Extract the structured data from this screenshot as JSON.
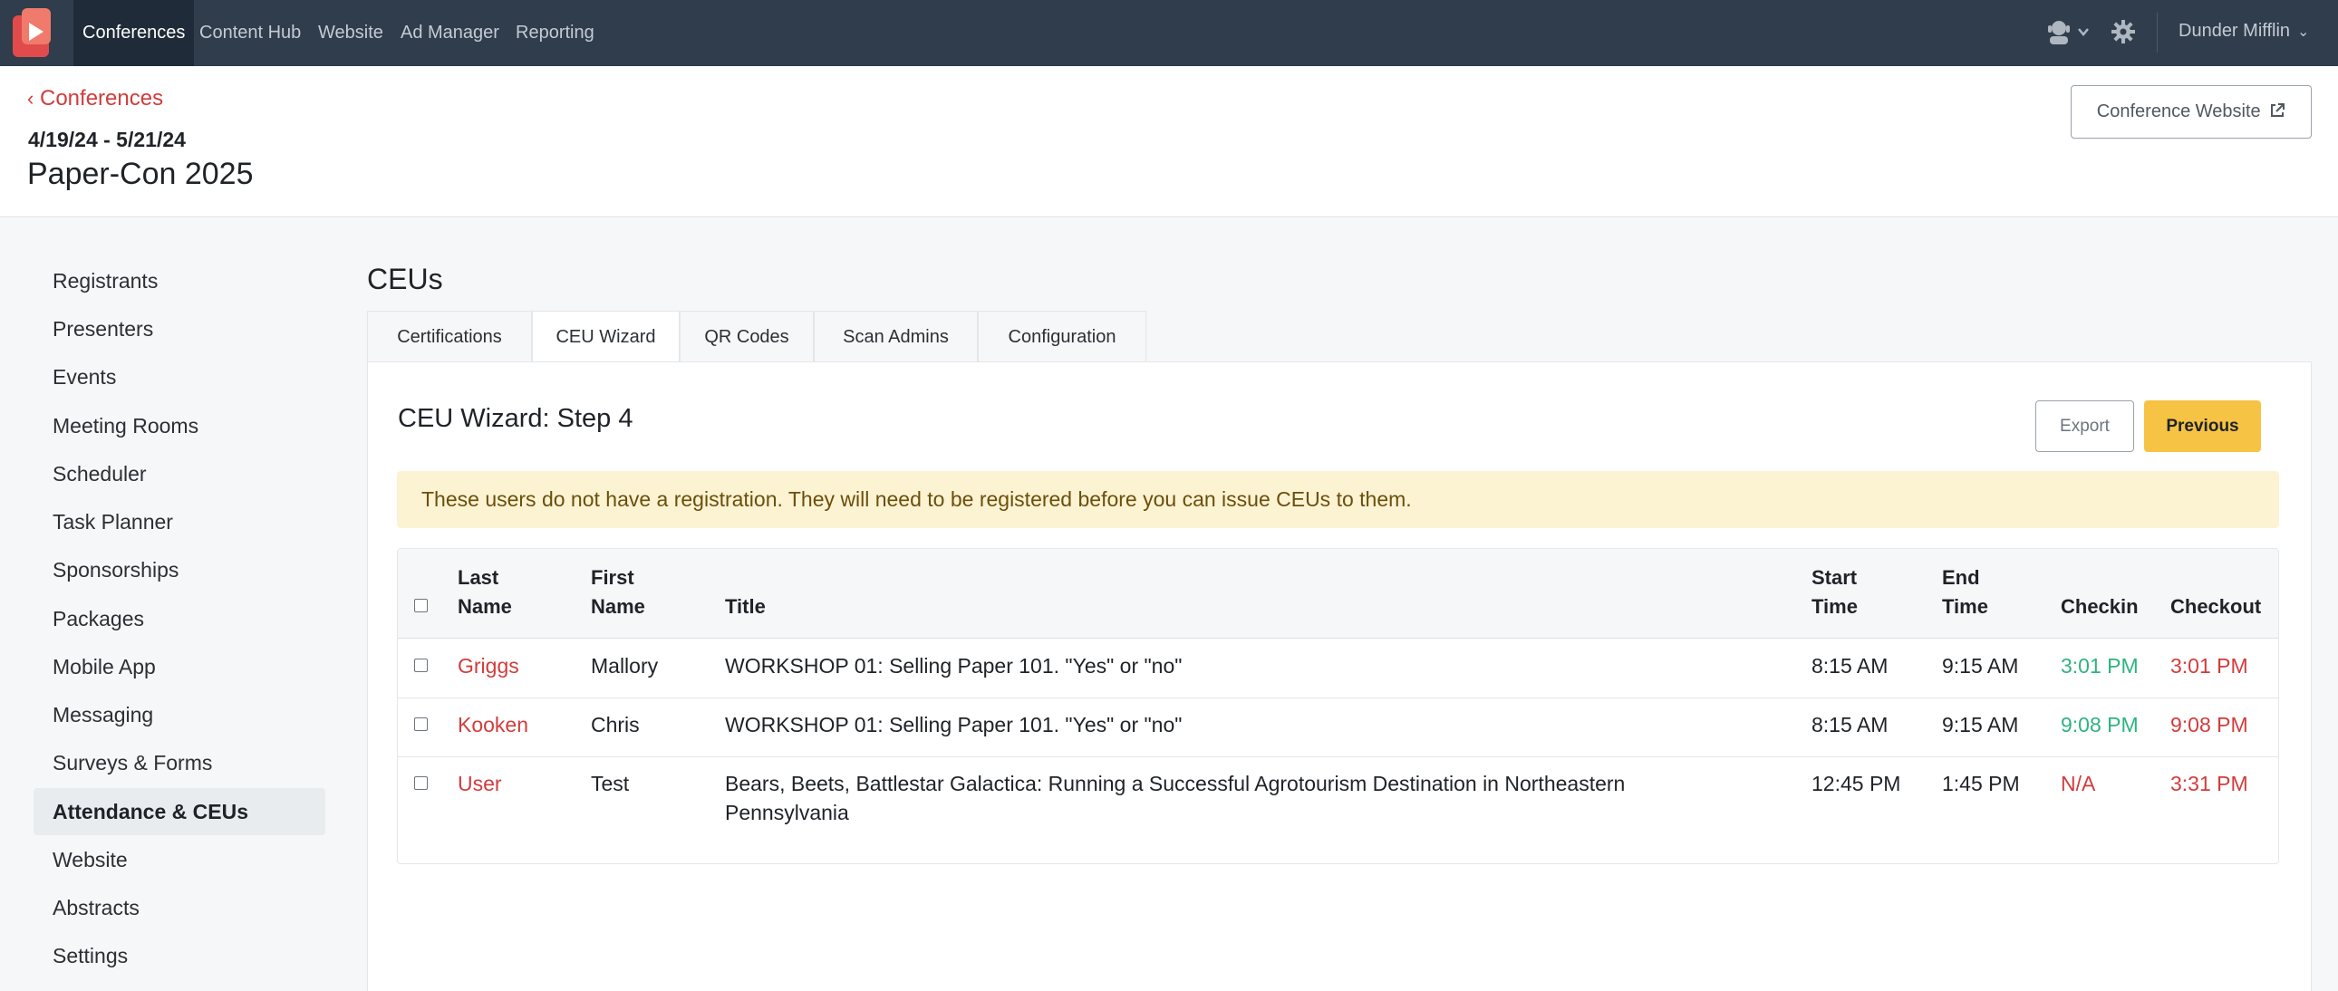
{
  "nav": {
    "items": [
      {
        "label": "Conferences",
        "active": true
      },
      {
        "label": "Content Hub"
      },
      {
        "label": "Website"
      },
      {
        "label": "Ad Manager"
      },
      {
        "label": "Reporting"
      }
    ],
    "company": "Dunder Mifflin",
    "icons": [
      "user-support-icon",
      "chevron-down-icon",
      "gear-icon"
    ]
  },
  "header": {
    "back_label": "Conferences",
    "date_range": "4/19/24 - 5/21/24",
    "title": "Paper-Con 2025",
    "site_button": "Conference Website"
  },
  "sidebar": {
    "items": [
      {
        "label": "Registrants"
      },
      {
        "label": "Presenters"
      },
      {
        "label": "Events"
      },
      {
        "label": "Meeting Rooms"
      },
      {
        "label": "Scheduler"
      },
      {
        "label": "Task Planner"
      },
      {
        "label": "Sponsorships"
      },
      {
        "label": "Packages"
      },
      {
        "label": "Mobile App"
      },
      {
        "label": "Messaging"
      },
      {
        "label": "Surveys & Forms"
      },
      {
        "label": "Attendance & CEUs",
        "active": true
      },
      {
        "label": "Website"
      },
      {
        "label": "Abstracts"
      },
      {
        "label": "Settings"
      }
    ]
  },
  "main": {
    "section_title": "CEUs",
    "tabs": [
      {
        "label": "Certifications"
      },
      {
        "label": "CEU Wizard",
        "active": true
      },
      {
        "label": "QR Codes"
      },
      {
        "label": "Scan Admins"
      },
      {
        "label": "Configuration"
      }
    ],
    "step_title": "CEU Wizard: Step 4",
    "export_label": "Export",
    "previous_label": "Previous",
    "alert": "These users do not have a registration. They will need to be registered before you can issue CEUs to them.",
    "table": {
      "headers": {
        "last_name": [
          "Last",
          "Name"
        ],
        "first_name": [
          "First",
          "Name"
        ],
        "title": "Title",
        "start_time": [
          "Start",
          "Time"
        ],
        "end_time": [
          "End",
          "Time"
        ],
        "checkin": "Checkin",
        "checkout": "Checkout"
      },
      "rows": [
        {
          "last": "Griggs",
          "first": "Mallory",
          "title": "WORKSHOP 01: Selling Paper 101. \"Yes\" or \"no\"",
          "start": "8:15 AM",
          "end": "9:15 AM",
          "checkin": "3:01 PM",
          "checkout": "3:01 PM"
        },
        {
          "last": "Kooken",
          "first": "Chris",
          "title": "WORKSHOP 01: Selling Paper 101. \"Yes\" or \"no\"",
          "start": "8:15 AM",
          "end": "9:15 AM",
          "checkin": "9:08 PM",
          "checkout": "9:08 PM"
        },
        {
          "last": "User",
          "first": "Test",
          "title_line1": "Bears, Beets, Battlestar Galactica: Running a Successful Agrotourism Destination in Northeastern",
          "title_line2": "Pennsylvania",
          "start": "12:45 PM",
          "end": "1:45 PM",
          "checkin": "N/A",
          "checkout": "3:31 PM"
        }
      ]
    }
  },
  "colors": {
    "nav_bg": "#2f3d4c",
    "accent_red": "#d23c3c",
    "checkin_green": "#2fb380",
    "button_yellow": "#f6c344",
    "alert_bg": "#fcf3d3"
  }
}
